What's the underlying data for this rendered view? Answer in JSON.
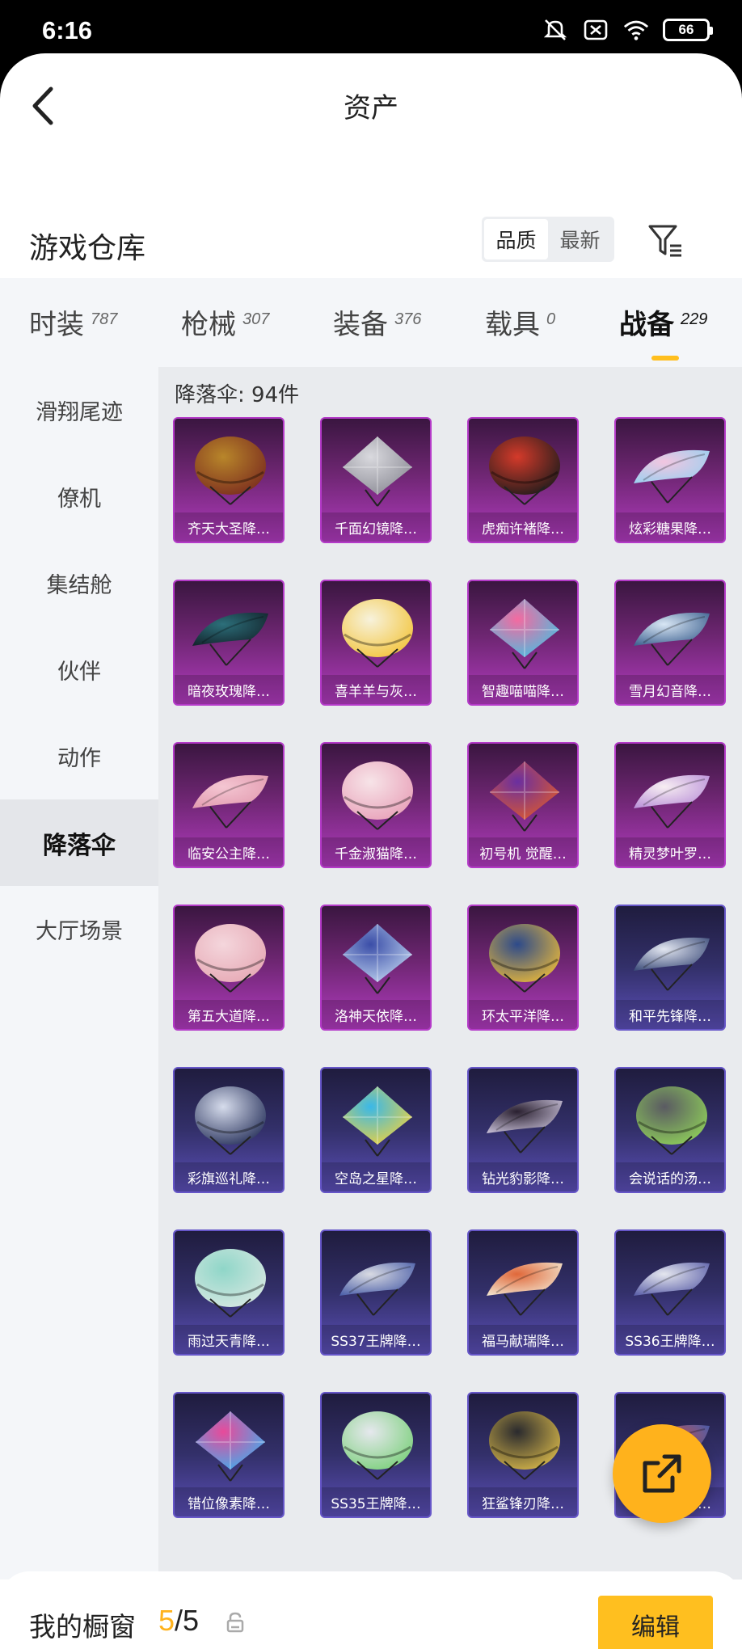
{
  "status": {
    "time": "6:16",
    "battery": "66",
    "icons": [
      "mute-icon",
      "sim-off-icon",
      "wifi-icon",
      "battery-icon"
    ]
  },
  "header": {
    "title": "资产",
    "back": "chevron-left-icon"
  },
  "warehouse": {
    "title": "游戏仓库",
    "sort_options": [
      "品质",
      "最新"
    ],
    "active_sort": "品质",
    "filter": "filter-icon"
  },
  "tabs": [
    {
      "label": "时装",
      "count": "787"
    },
    {
      "label": "枪械",
      "count": "307"
    },
    {
      "label": "装备",
      "count": "376"
    },
    {
      "label": "载具",
      "count": "0"
    },
    {
      "label": "战备",
      "count": "229"
    }
  ],
  "active_tab": "战备",
  "sidebar": [
    {
      "label": "滑翔尾迹"
    },
    {
      "label": "僚机"
    },
    {
      "label": "集结舱"
    },
    {
      "label": "伙伴"
    },
    {
      "label": "动作"
    },
    {
      "label": "降落伞"
    },
    {
      "label": "大厅场景"
    }
  ],
  "active_sidebar": "降落伞",
  "content": {
    "count_label": "降落伞: 94件",
    "items": [
      {
        "name": "齐天大圣降…",
        "tier": "purple",
        "color1": "#b8862a",
        "color2": "#7a2b1e",
        "shape": "round"
      },
      {
        "name": "千面幻镜降…",
        "tier": "purple",
        "color1": "#d9d9de",
        "color2": "#8a8a94",
        "shape": "diamond"
      },
      {
        "name": "虎痴许褚降…",
        "tier": "purple",
        "color1": "#d43a2a",
        "color2": "#1b1b1b",
        "shape": "round"
      },
      {
        "name": "炫彩糖果降…",
        "tier": "purple",
        "color1": "#f2c6e0",
        "color2": "#9bd0f0",
        "shape": "wing"
      },
      {
        "name": "暗夜玫瑰降…",
        "tier": "purple",
        "color1": "#2c6f7a",
        "color2": "#13232b",
        "shape": "wing"
      },
      {
        "name": "喜羊羊与灰…",
        "tier": "purple",
        "color1": "#f7f2dc",
        "color2": "#f3c43a",
        "shape": "round"
      },
      {
        "name": "智趣喵喵降…",
        "tier": "purple",
        "color1": "#f46aa0",
        "color2": "#43c0e3",
        "shape": "diamond"
      },
      {
        "name": "雪月幻音降…",
        "tier": "purple",
        "color1": "#d8e6f4",
        "color2": "#3b5f8e",
        "shape": "wing"
      },
      {
        "name": "临安公主降…",
        "tier": "purple",
        "color1": "#f4c6d2",
        "color2": "#e29bb0",
        "shape": "wing"
      },
      {
        "name": "千金淑猫降…",
        "tier": "purple",
        "color1": "#f7e4e8",
        "color2": "#e8a0b8",
        "shape": "round"
      },
      {
        "name": "初号机 觉醒…",
        "tier": "purple",
        "color1": "#6a2fa0",
        "color2": "#e05a2a",
        "shape": "diamond"
      },
      {
        "name": "精灵梦叶罗…",
        "tier": "purple",
        "color1": "#f7eef2",
        "color2": "#b98fd8",
        "shape": "wing"
      },
      {
        "name": "第五大道降…",
        "tier": "purple",
        "color1": "#f4d6dc",
        "color2": "#e6a8b4",
        "shape": "round"
      },
      {
        "name": "洛神天依降…",
        "tier": "purple",
        "color1": "#3b4ea8",
        "color2": "#c0d4f0",
        "shape": "diamond"
      },
      {
        "name": "环太平洋降…",
        "tier": "purple",
        "color1": "#2d4a8a",
        "color2": "#e8b83a",
        "shape": "round"
      },
      {
        "name": "和平先锋降…",
        "tier": "blue",
        "color1": "#e2e6f0",
        "color2": "#3a4a78",
        "shape": "wing"
      },
      {
        "name": "彩旗巡礼降…",
        "tier": "blue",
        "color1": "#d6dcec",
        "color2": "#26305a",
        "shape": "round"
      },
      {
        "name": "空岛之星降…",
        "tier": "blue",
        "color1": "#3ab8e8",
        "color2": "#f2d23a",
        "shape": "diamond"
      },
      {
        "name": "钻光豹影降…",
        "tier": "blue",
        "color1": "#2a2030",
        "color2": "#c8c0d8",
        "shape": "wing"
      },
      {
        "name": "会说话的汤…",
        "tier": "blue",
        "color1": "#5a5a62",
        "color2": "#8fd05a",
        "shape": "round"
      },
      {
        "name": "雨过天青降…",
        "tier": "blue",
        "color1": "#8fd6c8",
        "color2": "#d8e8e2",
        "shape": "round"
      },
      {
        "name": "SS37王牌降…",
        "tier": "blue",
        "color1": "#d8dae2",
        "color2": "#4a5ea8",
        "shape": "wing"
      },
      {
        "name": "福马献瑞降…",
        "tier": "blue",
        "color1": "#e0683a",
        "color2": "#f2e6d0",
        "shape": "wing"
      },
      {
        "name": "SS36王牌降…",
        "tier": "blue",
        "color1": "#e4e6ee",
        "color2": "#5a5ea8",
        "shape": "wing"
      },
      {
        "name": "错位像素降…",
        "tier": "blue",
        "color1": "#e84a9a",
        "color2": "#3ab0f0",
        "shape": "diamond"
      },
      {
        "name": "SS35王牌降…",
        "tier": "blue",
        "color1": "#e6e8ee",
        "color2": "#7ad07a",
        "shape": "round"
      },
      {
        "name": "狂鲨锋刃降…",
        "tier": "blue",
        "color1": "#2a2a2e",
        "color2": "#d8b84a",
        "shape": "round"
      },
      {
        "name": "蓝海之火降…",
        "tier": "blue",
        "color1": "#e05a4a",
        "color2": "#3a5ab0",
        "shape": "wing"
      }
    ]
  },
  "share_button": "share-icon",
  "bottom": {
    "window_title": "我的橱窗",
    "window_used": "5",
    "window_total": "/5",
    "edit_label": "编辑"
  }
}
